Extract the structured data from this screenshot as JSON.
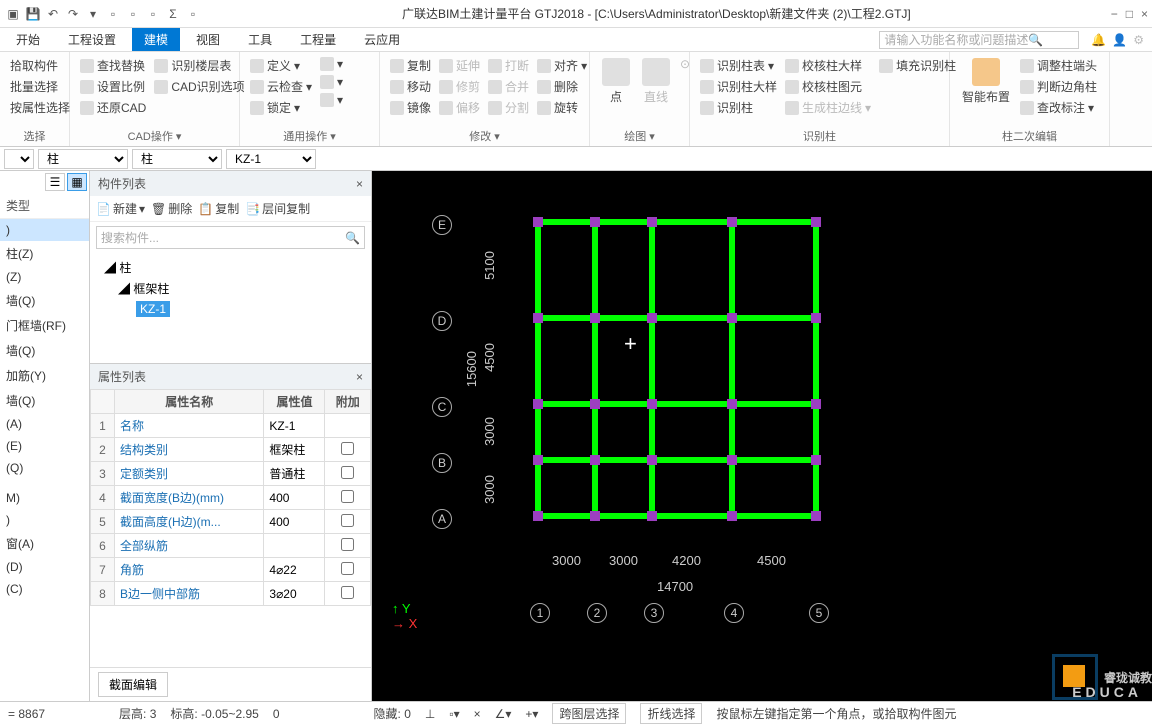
{
  "title": "广联达BIM土建计量平台 GTJ2018 - [C:\\Users\\Administrator\\Desktop\\新建文件夹 (2)\\工程2.GTJ]",
  "menu": {
    "tabs": [
      "开始",
      "工程设置",
      "建模",
      "视图",
      "工具",
      "工程量",
      "云应用"
    ],
    "active": 2,
    "search_placeholder": "请输入功能名称或问题描述"
  },
  "ribbon": {
    "g0": {
      "label": "选择",
      "items": [
        "拾取构件",
        "批量选择",
        "按属性选择"
      ]
    },
    "g1": {
      "label": "CAD操作 ▾",
      "items": [
        "查找替换",
        "设置比例",
        "还原CAD",
        "识别楼层表",
        "CAD识别选项"
      ]
    },
    "g2": {
      "label": "通用操作 ▾",
      "items": [
        "定义",
        "云检查",
        "锁定",
        "▾",
        "▾",
        "▾",
        "▾"
      ]
    },
    "g3": {
      "label": "修改 ▾",
      "items": [
        "复制",
        "移动",
        "镜像",
        "延伸",
        "修剪",
        "偏移",
        "打断",
        "合并",
        "分割",
        "对齐",
        "删除",
        "旋转"
      ]
    },
    "g4": {
      "label": "绘图 ▾",
      "items": [
        "点",
        "直线",
        "⊙"
      ]
    },
    "g5": {
      "label": "识别柱",
      "items": [
        "识别柱表",
        "识别柱大样",
        "识别柱",
        "校核柱大样",
        "校核柱图元",
        "生成柱边线",
        "填充识别柱"
      ]
    },
    "g6": {
      "label": "柱二次编辑",
      "big": "智能布置",
      "items": [
        "调整柱端头",
        "判断边角柱",
        "查改标注"
      ]
    }
  },
  "dropdowns": {
    "d1": "",
    "d2": "柱",
    "d3": "柱",
    "d4": "KZ-1"
  },
  "left_items": [
    ")",
    "柱(Z)",
    "(Z)",
    "墙(Q)",
    "门框墙(RF)",
    "墙(Q)",
    "加筋(Y)",
    "墙(Q)",
    "(A)",
    "(E)",
    "(Q)",
    "",
    "M)",
    ")",
    "窗(A)",
    "",
    "(D)",
    "(C)"
  ],
  "tree": {
    "title": "构件列表",
    "toolbar": [
      "新建",
      "删除",
      "复制",
      "层间复制"
    ],
    "search": "搜索构件...",
    "root": "柱",
    "sub": "框架柱",
    "leaf": "KZ-1"
  },
  "props": {
    "title": "属性列表",
    "headers": [
      "属性名称",
      "属性值",
      "附加"
    ],
    "rows": [
      {
        "n": "1",
        "name": "名称",
        "val": "KZ-1",
        "chk": false,
        "link": true
      },
      {
        "n": "2",
        "name": "结构类别",
        "val": "框架柱",
        "chk": false,
        "link": true
      },
      {
        "n": "3",
        "name": "定额类别",
        "val": "普通柱",
        "chk": false,
        "link": true
      },
      {
        "n": "4",
        "name": "截面宽度(B边)(mm)",
        "val": "400",
        "chk": false,
        "link": true
      },
      {
        "n": "5",
        "name": "截面高度(H边)(m...",
        "val": "400",
        "chk": false,
        "link": true
      },
      {
        "n": "6",
        "name": "全部纵筋",
        "val": "",
        "chk": false,
        "link": true
      },
      {
        "n": "7",
        "name": "角筋",
        "val": "4⌀22",
        "chk": false,
        "link": true
      },
      {
        "n": "8",
        "name": "B边一侧中部筋",
        "val": "3⌀20",
        "chk": false,
        "link": true
      }
    ],
    "edit": "截面编辑"
  },
  "drawing": {
    "rows": [
      "E",
      "D",
      "C",
      "B",
      "A"
    ],
    "cols": [
      "1",
      "2",
      "3",
      "4",
      "5"
    ],
    "hdims": [
      "3000",
      "3000",
      "4200",
      "4500"
    ],
    "htotal": "14700",
    "vdims": [
      "5100",
      "4500",
      "3000",
      "3000"
    ],
    "vtotal": "15600"
  },
  "status": {
    "coord": "= 8867",
    "floor_l": "层高:",
    "floor": "3",
    "elev_l": "标高:",
    "elev": "-0.05~2.95",
    "ang": "0",
    "hide_l": "隐藏:",
    "hide": "0",
    "btns": [
      "跨图层选择",
      "折线选择",
      "按鼠标左键指定第一个角点，或拾取构件图元"
    ]
  },
  "watermark": {
    "main": "睿珑诚教",
    "sub": "EDUCA"
  }
}
